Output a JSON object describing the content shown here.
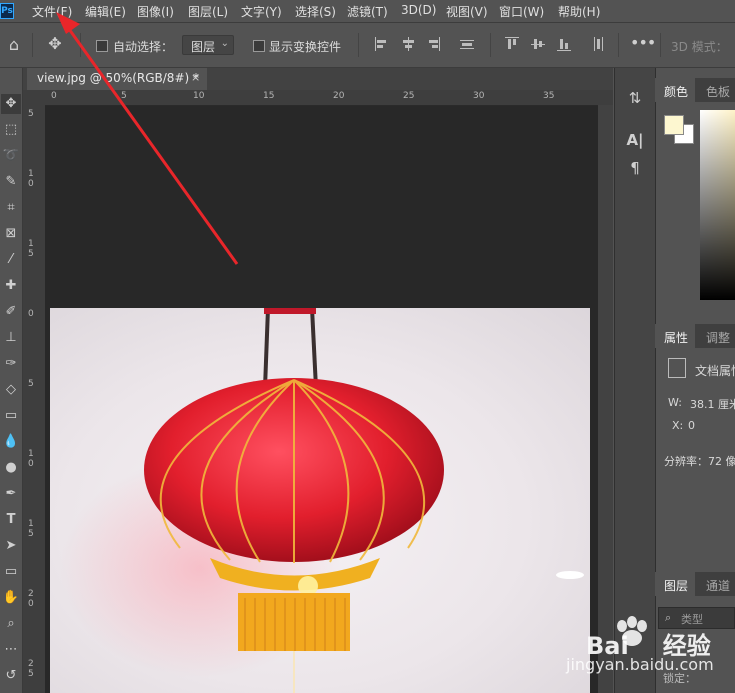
{
  "menubar": {
    "logo": "Ps",
    "items": [
      "文件(F)",
      "编辑(E)",
      "图像(I)",
      "图层(L)",
      "文字(Y)",
      "选择(S)",
      "滤镜(T)",
      "3D(D)",
      "视图(V)",
      "窗口(W)",
      "帮助(H)"
    ]
  },
  "options": {
    "auto_select_label": "自动选择：",
    "auto_select_value": "图层",
    "show_transform_label": "显示变换控件",
    "mode_3d_label": "3D 模式："
  },
  "document": {
    "tab_title": "view.jpg @ 50%(RGB/8#) *",
    "close_glyph": "×",
    "ruler_top_ticks": [
      "0",
      "5",
      "10",
      "15",
      "20",
      "25",
      "30",
      "35"
    ],
    "ruler_left_ticks": [
      "5",
      "1",
      "0",
      "1",
      "5",
      "0",
      "5",
      "1",
      "0",
      "1",
      "5",
      "2",
      "0",
      "2",
      "5"
    ]
  },
  "panels": {
    "color_tab": "颜色",
    "swatches_tab": "色板",
    "properties_tab": "属性",
    "adjust_tab": "调整",
    "doc_props_label": "文档属性",
    "width_label": "W:",
    "width_value": "38.1 厘米",
    "x_label": "X:",
    "x_value": "0",
    "resolution_label": "分辨率：72 像",
    "layers_tab": "图层",
    "channels_tab": "通道",
    "search_placeholder": "类型",
    "lock_label": "锁定："
  },
  "colors": {
    "foreground": "#fdf7d0",
    "background": "#ffffff",
    "lantern_red": "#e0222e",
    "lantern_gold": "#f0b020",
    "arrow_red": "#e8262a"
  },
  "watermark": {
    "brand": "Bai",
    "brand_tail": "经验",
    "url": "jingyan.baidu.com"
  }
}
